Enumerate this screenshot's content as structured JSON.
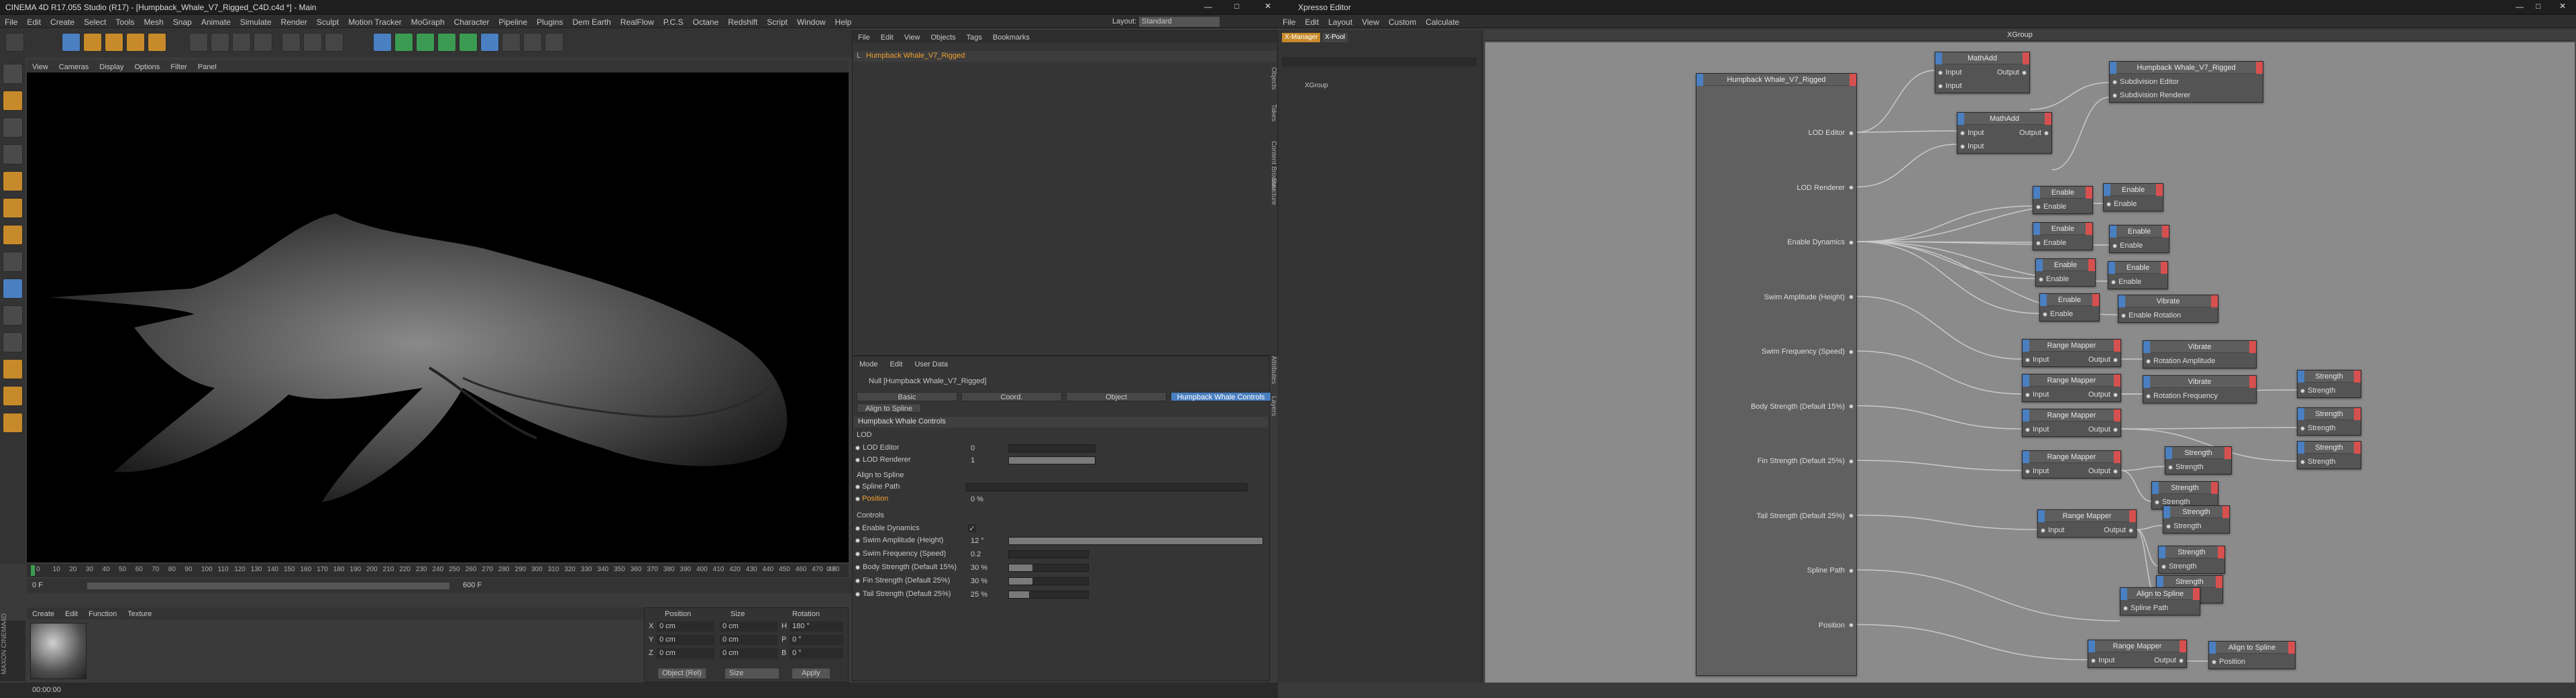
{
  "c4d": {
    "title": "CINEMA 4D R17.055 Studio (R17) - [Humpback_Whale_V7_Rigged_C4D.c4d *] - Main",
    "menu": [
      "File",
      "Edit",
      "Create",
      "Select",
      "Tools",
      "Mesh",
      "Snap",
      "Animate",
      "Simulate",
      "Render",
      "Sculpt",
      "Motion Tracker",
      "MoGraph",
      "Character",
      "Pipeline",
      "Plugins",
      "Dem Earth",
      "RealFlow",
      "P.C.S",
      "Octane",
      "Redshift",
      "Script",
      "Window",
      "Help"
    ],
    "layout_label": "Layout:",
    "layout_value": "Standard",
    "viewport_menu": [
      "View",
      "Cameras",
      "Display",
      "Options",
      "Filter",
      "Panel"
    ],
    "timeline_ticks": [
      "0",
      "10",
      "20",
      "30",
      "40",
      "50",
      "60",
      "70",
      "80",
      "90",
      "100",
      "110",
      "120",
      "130",
      "140",
      "150",
      "160",
      "170",
      "180",
      "190",
      "200",
      "210",
      "220",
      "230",
      "240",
      "250",
      "260",
      "270",
      "280",
      "290",
      "300",
      "310",
      "320",
      "330",
      "340",
      "350",
      "360",
      "370",
      "380",
      "390",
      "400",
      "410",
      "420",
      "430",
      "440",
      "450",
      "460",
      "470",
      "480"
    ],
    "timeline_end": "0 F",
    "frame_start": "0 F",
    "frame_end": "600 F",
    "fps_field": "600 F",
    "material_menu": [
      "Create",
      "Edit",
      "Function",
      "Texture"
    ],
    "coords": {
      "headers": [
        "Position",
        "Size",
        "Rotation"
      ],
      "rows": [
        {
          "axis": "X",
          "pos": "0 cm",
          "size": "0 cm",
          "rot_label": "H",
          "rot": "180 °"
        },
        {
          "axis": "Y",
          "pos": "0 cm",
          "size": "0 cm",
          "rot_label": "P",
          "rot": "0 °"
        },
        {
          "axis": "Z",
          "pos": "0 cm",
          "size": "0 cm",
          "rot_label": "B",
          "rot": "0 °"
        }
      ],
      "mode1": "Object (Rel)",
      "mode2": "Size",
      "apply": "Apply"
    },
    "status_time": "00:00:00",
    "maxon_logo": "MAXON CINEMA4D",
    "object_manager": {
      "menu": [
        "File",
        "Edit",
        "View",
        "Objects",
        "Tags",
        "Bookmarks"
      ],
      "object": "Humpback Whale_V7_Rigged"
    },
    "attributes": {
      "menu": [
        "Mode",
        "Edit",
        "User Data"
      ],
      "title": "Null [Humpback Whale_V7_Rigged]",
      "tabs": [
        "Basic",
        "Coord.",
        "Object",
        "Humpback Whale Controls"
      ],
      "tab2": "Align to Spline",
      "section": "Humpback Whale Controls",
      "lod_header": "LOD",
      "lod_rows": [
        {
          "label": "LOD Editor",
          "value": "0",
          "fill": 0
        },
        {
          "label": "LOD Renderer",
          "value": "1",
          "fill": 1
        }
      ],
      "align_header": "Align to Spline",
      "spline_path_label": "Spline Path",
      "position_label": "Position",
      "position_value": "0 %",
      "controls_header": "Controls",
      "enable_dynamics_label": "Enable Dynamics",
      "enable_dynamics_check": "✓",
      "control_rows": [
        {
          "label": "Swim Amplitude (Height)",
          "value": "12 °",
          "fill": 1
        },
        {
          "label": "Swim Frequency (Speed)",
          "value": "0.2",
          "fill": 0
        },
        {
          "label": "Body Strength (Default 15%)",
          "value": "30 %",
          "fill": 0.3
        },
        {
          "label": "Fin Strength (Default 25%)",
          "value": "30 %",
          "fill": 0.3
        },
        {
          "label": "Tail Strength (Default 25%)",
          "value": "25 %",
          "fill": 0.25
        }
      ]
    },
    "side_tabs": [
      "Objects",
      "Takes",
      "Content Browser",
      "Structure"
    ],
    "attr_side_tabs": [
      "Attributes",
      "Layers"
    ]
  },
  "xpresso": {
    "title": "Xpresso Editor",
    "menu": [
      "File",
      "Edit",
      "Layout",
      "View",
      "Custom",
      "Calculate"
    ],
    "tabs": [
      "X-Manager",
      "X-Pool"
    ],
    "tree_item": "XGroup",
    "group_title": "XGroup",
    "main_node": {
      "title": "Humpback Whale_V7_Rigged",
      "ports": [
        "LOD Editor",
        "LOD Renderer",
        "Enable Dynamics",
        "Swim Amplitude (Height)",
        "Swim Frequency (Speed)",
        "Body Strength (Default 15%)",
        "Fin Strength (Default 25%)",
        "Tail Strength (Default 25%)",
        "Spline Path",
        "Position"
      ]
    },
    "nodes": [
      {
        "title": "MathAdd",
        "inputs": [
          "Input",
          "Input"
        ],
        "outputs": [
          "Output"
        ]
      },
      {
        "title": "MathAdd",
        "inputs": [
          "Input",
          "Input"
        ],
        "outputs": [
          "Output"
        ]
      },
      {
        "title": "Humpback Whale_V7_Rigged",
        "inputs": [
          "Subdivision Editor",
          "Subdivision Renderer"
        ],
        "outputs": []
      },
      {
        "title": "Enable",
        "inputs": [
          "Enable"
        ],
        "outputs": []
      },
      {
        "title": "Enable",
        "inputs": [
          "Enable"
        ],
        "outputs": []
      },
      {
        "title": "Enable",
        "inputs": [
          "Enable"
        ],
        "outputs": []
      },
      {
        "title": "Enable",
        "inputs": [
          "Enable"
        ],
        "outputs": []
      },
      {
        "title": "Enable",
        "inputs": [
          "Enable"
        ],
        "outputs": []
      },
      {
        "title": "Enable",
        "inputs": [
          "Enable"
        ],
        "outputs": []
      },
      {
        "title": "Enable",
        "inputs": [
          "Enable"
        ],
        "outputs": []
      },
      {
        "title": "Vibrate",
        "inputs": [
          "Enable Rotation"
        ],
        "outputs": []
      },
      {
        "title": "Range Mapper",
        "inputs": [
          "Input"
        ],
        "outputs": [
          "Output"
        ]
      },
      {
        "title": "Vibrate",
        "inputs": [
          "Rotation Amplitude"
        ],
        "outputs": []
      },
      {
        "title": "Range Mapper",
        "inputs": [
          "Input"
        ],
        "outputs": [
          "Output"
        ]
      },
      {
        "title": "Vibrate",
        "inputs": [
          "Rotation Frequency"
        ],
        "outputs": []
      },
      {
        "title": "Strength",
        "inputs": [
          "Strength"
        ],
        "outputs": []
      },
      {
        "title": "Range Mapper",
        "inputs": [
          "Input"
        ],
        "outputs": [
          "Output"
        ]
      },
      {
        "title": "Strength",
        "inputs": [
          "Strength"
        ],
        "outputs": []
      },
      {
        "title": "Strength",
        "inputs": [
          "Strength"
        ],
        "outputs": []
      },
      {
        "title": "Range Mapper",
        "inputs": [
          "Input"
        ],
        "outputs": [
          "Output"
        ]
      },
      {
        "title": "Strength",
        "inputs": [
          "Strength"
        ],
        "outputs": []
      },
      {
        "title": "Strength",
        "inputs": [
          "Strength"
        ],
        "outputs": []
      },
      {
        "title": "Strength",
        "inputs": [
          "Strength"
        ],
        "outputs": []
      },
      {
        "title": "Range Mapper",
        "inputs": [
          "Input"
        ],
        "outputs": [
          "Output"
        ]
      },
      {
        "title": "Strength",
        "inputs": [
          "Strength"
        ],
        "outputs": []
      },
      {
        "title": "Strength",
        "inputs": [
          "Strength"
        ],
        "outputs": []
      },
      {
        "title": "Align to Spline",
        "inputs": [
          "Spline Path"
        ],
        "outputs": []
      },
      {
        "title": "Range Mapper",
        "inputs": [
          "Input"
        ],
        "outputs": [
          "Output"
        ]
      },
      {
        "title": "Align to Spline",
        "inputs": [
          "Position"
        ],
        "outputs": []
      }
    ]
  }
}
